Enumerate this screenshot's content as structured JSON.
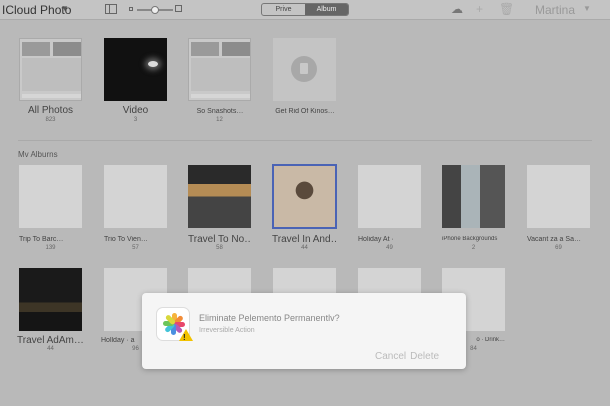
{
  "toolbar": {
    "app_title": "ICloud Photo",
    "segments": [
      "Prive",
      "Album"
    ],
    "active_segment": 1,
    "zoom_level": 0.5,
    "user": "Martina",
    "icons": [
      "sidebar-icon",
      "zoom-slider",
      "upload-icon",
      "add-icon",
      "trash-icon",
      "chevron-down-icon"
    ]
  },
  "top_albums": [
    {
      "title": "All Photos",
      "count": "823",
      "thumb": "collage"
    },
    {
      "title": "Video",
      "count": "3",
      "thumb": "video"
    },
    {
      "title": "So Snashots…",
      "count": "12",
      "thumb": "collage"
    },
    {
      "title": "Get Rid Of Kinos…",
      "count": "",
      "thumb": "trash"
    }
  ],
  "section_label": "Mv Alburns",
  "my_albums_row1": [
    {
      "title": "Trip To Barc…",
      "count": "139",
      "thumb": "blank"
    },
    {
      "title": "Trio To Vien…",
      "count": "57",
      "thumb": "blank"
    },
    {
      "title": "Travel To No…",
      "count": "58",
      "thumb": "bar"
    },
    {
      "title": "Travel In And…",
      "count": "44",
      "thumb": "hard"
    },
    {
      "title": "Holiday At ·",
      "count": "49",
      "thumb": "blank"
    },
    {
      "title": "iPhone Backgrounds",
      "count": "2",
      "thumb": "fall"
    },
    {
      "title": "Vacant za a Sa…",
      "count": "69",
      "thumb": "blank"
    }
  ],
  "my_albums_row2": [
    {
      "title": "Travel AdAm…",
      "count": "44",
      "thumb": "night"
    },
    {
      "title": "Hollday · a",
      "count": "96",
      "thumb": "blank"
    },
    {
      "title": "",
      "count": "",
      "thumb": "blank"
    },
    {
      "title": "",
      "count": "",
      "thumb": "blank"
    },
    {
      "title": "",
      "count": "",
      "thumb": "blank"
    },
    {
      "title": "o · Drink…",
      "count": "84",
      "thumb": "blank"
    }
  ],
  "dialog": {
    "title": "Eliminate Pelemento Permanentlv?",
    "subtitle": "Irreversible Action",
    "cancel_label": "Cancel",
    "delete_label": "Delete"
  },
  "colors": {
    "background": "#b9b9b9",
    "selection": "#4a63b5",
    "warning": "#f2c200"
  }
}
